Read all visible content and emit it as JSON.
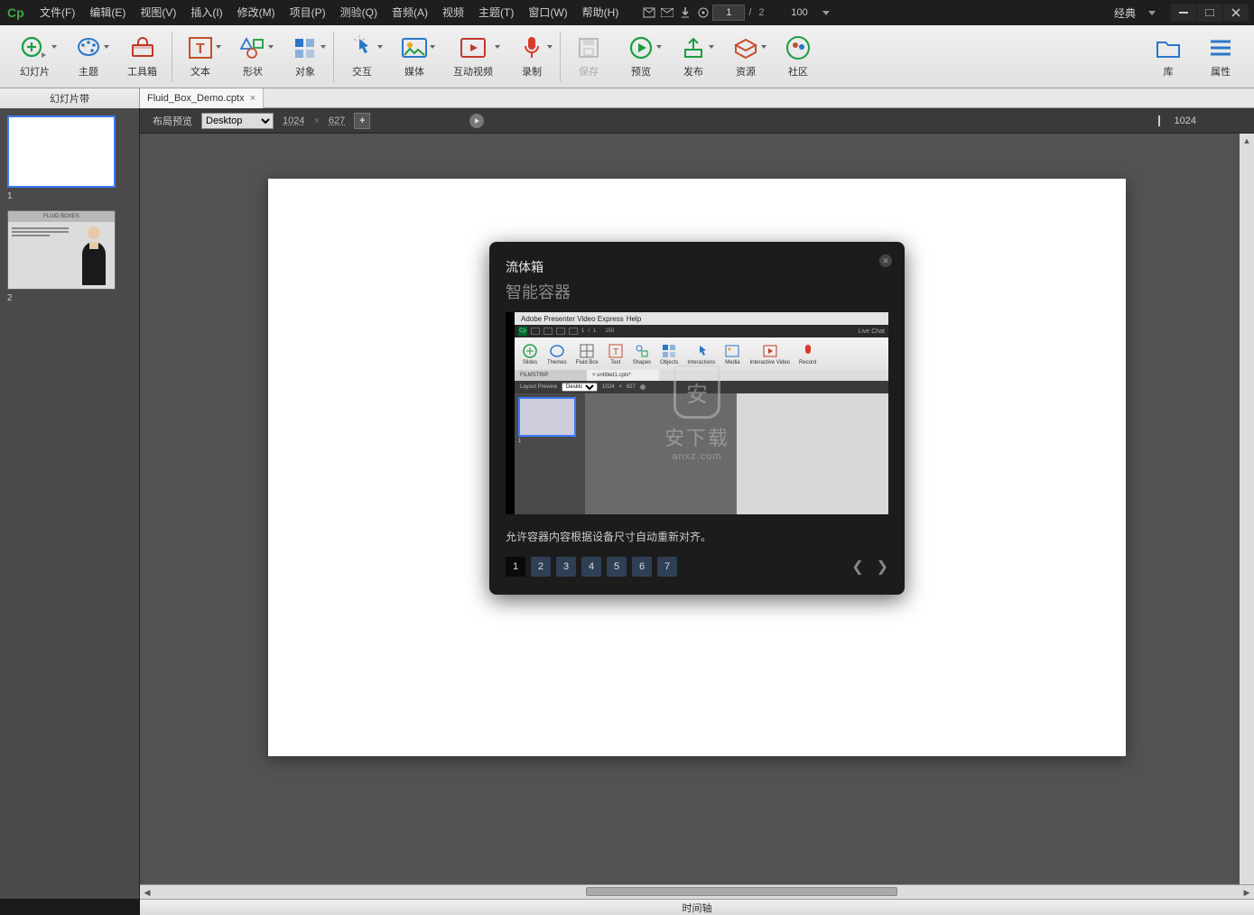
{
  "menu": {
    "items": [
      "文件(F)",
      "编辑(E)",
      "视图(V)",
      "插入(I)",
      "修改(M)",
      "项目(P)",
      "测验(Q)",
      "音频(A)",
      "视频",
      "主题(T)",
      "窗口(W)",
      "帮助(H)"
    ],
    "page_current": "1",
    "page_sep": "/",
    "page_total": "2",
    "zoom": "100",
    "workspace": "经典"
  },
  "ribbon": {
    "slides": "幻灯片",
    "themes": "主题",
    "toolbox": "工具箱",
    "text": "文本",
    "shapes": "形状",
    "objects": "对象",
    "interaction": "交互",
    "media": "媒体",
    "ivideo": "互动视频",
    "record": "录制",
    "save": "保存",
    "preview": "预览",
    "publish": "发布",
    "assets": "资源",
    "community": "社区",
    "library": "库",
    "properties": "属性"
  },
  "tabs": {
    "filmstrip": "幻灯片带",
    "doc": "Fluid_Box_Demo.cptx"
  },
  "layoutbar": {
    "label": "布局预览",
    "device": "Desktop",
    "w": "1024",
    "h": "627",
    "ruler": "1024"
  },
  "thumbs": {
    "n1": "1",
    "n2": "2",
    "t2_header": "FLUID BOXES"
  },
  "tooltip": {
    "title": "流体箱",
    "subtitle": "智能容器",
    "desc": "允许容器内容根据设备尺寸自动重新对齐。",
    "pages": [
      "1",
      "2",
      "3",
      "4",
      "5",
      "6",
      "7"
    ],
    "preview": {
      "app_title": "Adobe Presenter Video Express",
      "help": "Help",
      "livechat": "Live Chat",
      "pg_cur": "1",
      "pg_sep": "/",
      "pg_tot": "1",
      "zoom": "150",
      "rib": [
        "Slides",
        "Themes",
        "Fluid Box",
        "Text",
        "Shapes",
        "Objects",
        "Interactions",
        "Media",
        "Interactive Video",
        "Record"
      ],
      "tab1": "FILMSTRIP",
      "tab2": "untitled1.cptx*",
      "layout": "Layout Preview",
      "device": "Desktop",
      "w": "1024",
      "h": "627",
      "thumb_n": "1"
    },
    "watermark": {
      "glyph": "安",
      "big": "安下载",
      "small": "anxz.com"
    }
  },
  "timeline": "时间轴"
}
